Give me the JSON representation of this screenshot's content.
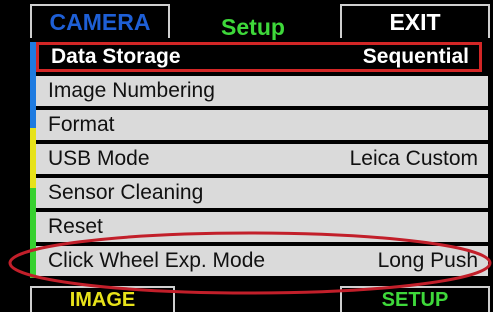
{
  "tabs": {
    "camera": "CAMERA",
    "setup": "Setup",
    "exit": "EXIT"
  },
  "menu": {
    "items": [
      {
        "label": "Data Storage",
        "value": "Sequential",
        "selected": true
      },
      {
        "label": "Image Numbering",
        "value": ""
      },
      {
        "label": "Format",
        "value": ""
      },
      {
        "label": "USB Mode",
        "value": "Leica Custom"
      },
      {
        "label": "Sensor Cleaning",
        "value": ""
      },
      {
        "label": "Reset",
        "value": ""
      },
      {
        "label": "Click Wheel Exp. Mode",
        "value": "Long Push"
      }
    ]
  },
  "bottom_tabs": {
    "image": "IMAGE",
    "setup": "SETUP"
  },
  "colors": {
    "camera_tab": "#1e5fd6",
    "setup_tab": "#3ed83a",
    "image_tab": "#e7e21a",
    "selection_border": "#d32626",
    "annotation_ellipse": "#c21f2a",
    "row_background": "#dadada",
    "strip_blue": "#1e7be0",
    "strip_yellow": "#e7e21a",
    "strip_green": "#37d12f"
  }
}
